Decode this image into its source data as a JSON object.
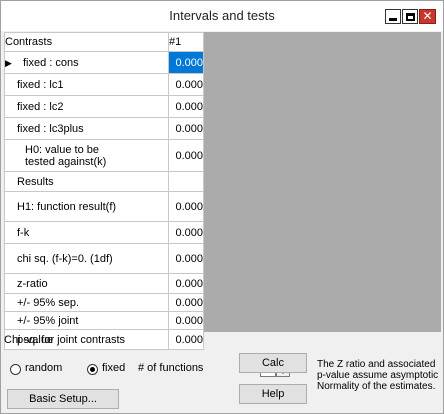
{
  "window": {
    "title": "Intervals and tests"
  },
  "grid": {
    "header": {
      "label": "Contrasts",
      "col": "#1"
    },
    "rows": [
      {
        "label": "fixed : cons",
        "value": "0.000",
        "pointer": "▶",
        "selected": true
      },
      {
        "label": "fixed : lc1",
        "value": "0.000"
      },
      {
        "label": "fixed : lc2",
        "value": "0.000"
      },
      {
        "label": "fixed : lc3plus",
        "value": "0.000"
      },
      {
        "label": "H0: value to be tested against(k)",
        "value": "0.000"
      },
      {
        "label": "Results",
        "value": ""
      },
      {
        "label": "H1: function result(f)",
        "value": "0.000"
      },
      {
        "label": "f-k",
        "value": "0.000"
      },
      {
        "label": "chi sq. (f-k)=0. (1df)",
        "value": "0.000"
      },
      {
        "label": "z-ratio",
        "value": "0.000"
      },
      {
        "label": "+/- 95% sep.",
        "value": "0.000"
      },
      {
        "label": "+/- 95% joint",
        "value": "0.000"
      },
      {
        "label": "p-value",
        "value": "0.000"
      }
    ]
  },
  "status": {
    "text": "Chi sq. for joint contrasts"
  },
  "controls": {
    "random_label": "random",
    "fixed_label": "fixed",
    "functions_label": "# of functions",
    "functions_value": "1",
    "calc_label": "Calc",
    "help_label": "Help",
    "basic_setup_label": "Basic Setup...",
    "note": "The Z ratio and associated p-value assume asymptotic Normality of the estimates."
  }
}
